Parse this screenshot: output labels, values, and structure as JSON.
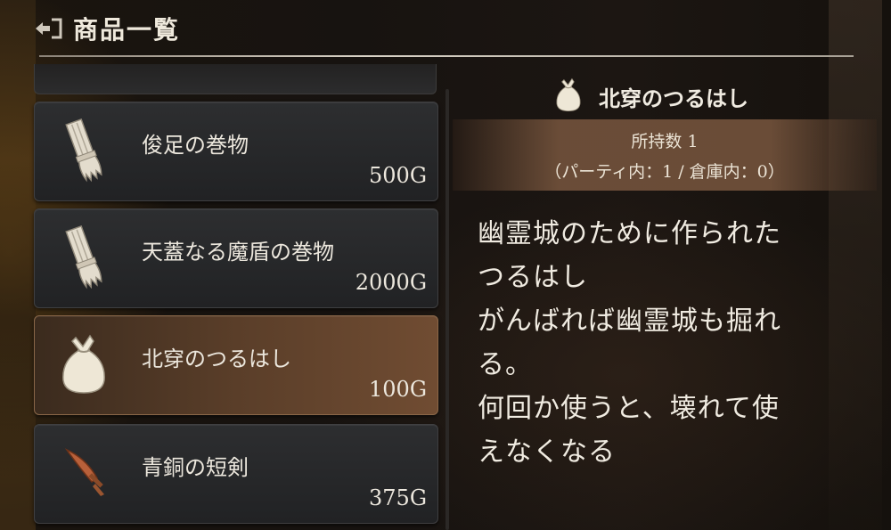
{
  "header": {
    "back_icon": "back-arrow-icon",
    "title": "商品一覧"
  },
  "items": [
    {
      "name": "俊足の巻物",
      "price": "500G",
      "icon": "scroll-icon",
      "selected": false
    },
    {
      "name": "天蓋なる魔盾の巻物",
      "price": "2000G",
      "icon": "scroll-icon",
      "selected": false
    },
    {
      "name": "北穿のつるはし",
      "price": "100G",
      "icon": "sack-icon",
      "selected": true
    },
    {
      "name": "青銅の短剣",
      "price": "375G",
      "icon": "dagger-icon",
      "selected": false
    }
  ],
  "detail": {
    "icon": "sack-icon",
    "title": "北穿のつるはし",
    "owned": "所持数 1",
    "owned_breakdown": "（パーティ内：1 / 倉庫内：0）",
    "description_lines": [
      "幽霊城のために作られた",
      "つるはし",
      "がんばれば幽霊城も掘れ",
      "る。",
      "何回か使うと、壊れて使",
      "えなくなる"
    ]
  },
  "colors": {
    "selected_accent": "#704c32",
    "panel": "#2d2e30",
    "text": "#ece7dd"
  }
}
